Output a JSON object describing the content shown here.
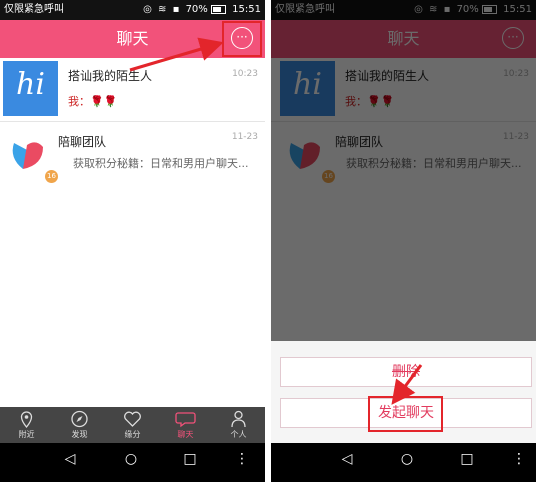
{
  "status_bar": {
    "carrier": "仅限紧急呼叫",
    "battery_percent": "70%",
    "time": "15:51"
  },
  "header": {
    "title": "聊天",
    "more_icon": "more-dots-icon"
  },
  "chats": [
    {
      "name": "搭讪我的陌生人",
      "time": "10:23",
      "preview": "我：🌹🌹",
      "avatar_text": "hi"
    },
    {
      "name": "陪聊团队",
      "time": "11-23",
      "preview": "获取积分秘籍：日常和男用户聊天...",
      "badge": "16"
    }
  ],
  "tabs": [
    {
      "label": "附近",
      "icon": "location-pin-icon"
    },
    {
      "label": "发现",
      "icon": "compass-icon"
    },
    {
      "label": "缘分",
      "icon": "heart-icon"
    },
    {
      "label": "聊天",
      "icon": "chat-bubble-icon",
      "active": true
    },
    {
      "label": "个人",
      "icon": "person-icon"
    }
  ],
  "nav_bar": {
    "back": "◁",
    "home": "○",
    "recents": "□",
    "menu": "⋮"
  },
  "sheet": {
    "option_top": "删除",
    "option_start_chat": "发起聊天"
  },
  "colors": {
    "accent": "#f2527a",
    "highlight": "#e3252b",
    "tab_bar": "#454545"
  }
}
